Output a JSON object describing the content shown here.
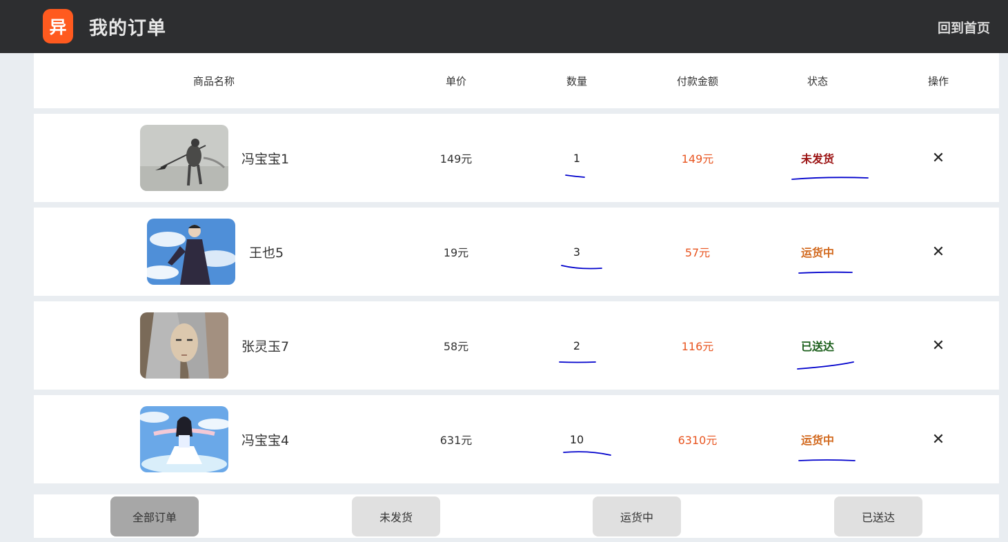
{
  "header": {
    "logo_glyph": "异",
    "title": "我的订单",
    "home_link": "回到首页"
  },
  "columns": {
    "name": "商品名称",
    "price": "单价",
    "qty": "数量",
    "pay": "付款金额",
    "status": "状态",
    "op": "操作"
  },
  "orders": [
    {
      "name": "冯宝宝1",
      "price": "149元",
      "qty": "1",
      "pay": "149元",
      "status": "未发货",
      "status_color": "#9b1212",
      "op": "✕",
      "image": "ink-wash warrior with spear"
    },
    {
      "name": "王也5",
      "price": "19元",
      "qty": "3",
      "pay": "57元",
      "status": "运货中",
      "status_color": "#d2691e",
      "op": "✕",
      "image": "man in dark robe under blue sky"
    },
    {
      "name": "张灵玉7",
      "price": "58元",
      "qty": "2",
      "pay": "116元",
      "status": "已送达",
      "status_color": "#1a5e1a",
      "op": "✕",
      "image": "long-haired figure portrait"
    },
    {
      "name": "冯宝宝4",
      "price": "631元",
      "qty": "10",
      "pay": "6310元",
      "status": "运货中",
      "status_color": "#d2691e",
      "op": "✕",
      "image": "girl in white dress under blue sky"
    }
  ],
  "tabs": [
    {
      "label": "全部订单",
      "active": true
    },
    {
      "label": "未发货",
      "active": false
    },
    {
      "label": "运货中",
      "active": false
    },
    {
      "label": "已送达",
      "active": false
    }
  ],
  "colors": {
    "topbar": "#2d2e30",
    "brand": "#ff5a1f",
    "pay_amount": "#e8541f",
    "annotation_ink": "#0000cc"
  }
}
